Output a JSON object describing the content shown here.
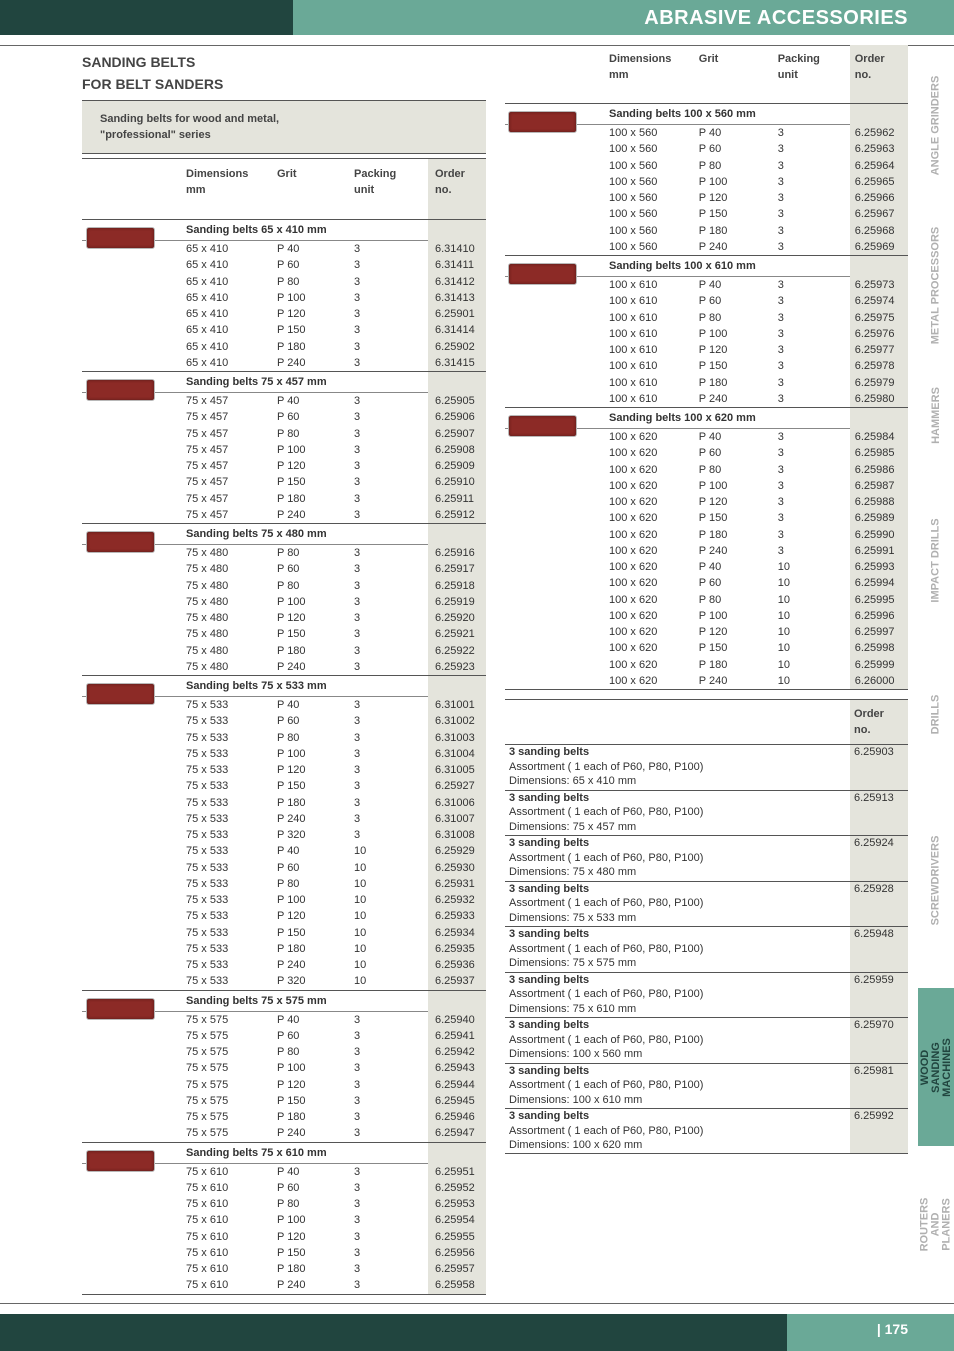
{
  "header": {
    "title": "ABRASIVE ACCESSORIES"
  },
  "footer": {
    "page": "| 175"
  },
  "section": {
    "title_line1": "SANDING BELTS",
    "title_line2": "FOR BELT SANDERS"
  },
  "intro": {
    "line1": "Sanding belts for wood and metal,",
    "line2": "\"professional\" series"
  },
  "columns": {
    "dim1": "Dimensions",
    "dim2": "mm",
    "grit": "Grit",
    "pack1": "Packing",
    "pack2": "unit",
    "ord1": "Order",
    "ord2": "no."
  },
  "left_groups": [
    {
      "title": "Sanding belts 65 x 410 mm",
      "rows": [
        [
          "65 x 410",
          "P 40",
          "3",
          "6.31410"
        ],
        [
          "65 x 410",
          "P 60",
          "3",
          "6.31411"
        ],
        [
          "65 x 410",
          "P 80",
          "3",
          "6.31412"
        ],
        [
          "65 x 410",
          "P 100",
          "3",
          "6.31413"
        ],
        [
          "65 x 410",
          "P 120",
          "3",
          "6.25901"
        ],
        [
          "65 x 410",
          "P 150",
          "3",
          "6.31414"
        ],
        [
          "65 x 410",
          "P 180",
          "3",
          "6.25902"
        ],
        [
          "65 x 410",
          "P 240",
          "3",
          "6.31415"
        ]
      ]
    },
    {
      "title": "Sanding belts 75 x 457 mm",
      "rows": [
        [
          "75 x 457",
          "P 40",
          "3",
          "6.25905"
        ],
        [
          "75 x 457",
          "P 60",
          "3",
          "6.25906"
        ],
        [
          "75 x 457",
          "P 80",
          "3",
          "6.25907"
        ],
        [
          "75 x 457",
          "P 100",
          "3",
          "6.25908"
        ],
        [
          "75 x 457",
          "P 120",
          "3",
          "6.25909"
        ],
        [
          "75 x 457",
          "P 150",
          "3",
          "6.25910"
        ],
        [
          "75 x 457",
          "P 180",
          "3",
          "6.25911"
        ],
        [
          "75 x 457",
          "P 240",
          "3",
          "6.25912"
        ]
      ]
    },
    {
      "title": "Sanding belts 75 x 480 mm",
      "rows": [
        [
          "75 x 480",
          "P 80",
          "3",
          "6.25916"
        ],
        [
          "75 x 480",
          "P 60",
          "3",
          "6.25917"
        ],
        [
          "75 x 480",
          "P 80",
          "3",
          "6.25918"
        ],
        [
          "75 x 480",
          "P 100",
          "3",
          "6.25919"
        ],
        [
          "75 x 480",
          "P 120",
          "3",
          "6.25920"
        ],
        [
          "75 x 480",
          "P 150",
          "3",
          "6.25921"
        ],
        [
          "75 x 480",
          "P 180",
          "3",
          "6.25922"
        ],
        [
          "75 x 480",
          "P 240",
          "3",
          "6.25923"
        ]
      ]
    },
    {
      "title": "Sanding belts 75 x 533 mm",
      "rows": [
        [
          "75 x 533",
          "P 40",
          "3",
          "6.31001"
        ],
        [
          "75 x 533",
          "P 60",
          "3",
          "6.31002"
        ],
        [
          "75 x 533",
          "P 80",
          "3",
          "6.31003"
        ],
        [
          "75 x 533",
          "P 100",
          "3",
          "6.31004"
        ],
        [
          "75 x 533",
          "P 120",
          "3",
          "6.31005"
        ],
        [
          "75 x 533",
          "P 150",
          "3",
          "6.25927"
        ],
        [
          "75 x 533",
          "P 180",
          "3",
          "6.31006"
        ],
        [
          "75 x 533",
          "P 240",
          "3",
          "6.31007"
        ],
        [
          "75 x 533",
          "P 320",
          "3",
          "6.31008"
        ],
        [
          "75 x 533",
          "P 40",
          "10",
          "6.25929"
        ],
        [
          "75 x 533",
          "P 60",
          "10",
          "6.25930"
        ],
        [
          "75 x 533",
          "P 80",
          "10",
          "6.25931"
        ],
        [
          "75 x 533",
          "P 100",
          "10",
          "6.25932"
        ],
        [
          "75 x 533",
          "P 120",
          "10",
          "6.25933"
        ],
        [
          "75 x 533",
          "P 150",
          "10",
          "6.25934"
        ],
        [
          "75 x 533",
          "P 180",
          "10",
          "6.25935"
        ],
        [
          "75 x 533",
          "P 240",
          "10",
          "6.25936"
        ],
        [
          "75 x 533",
          "P 320",
          "10",
          "6.25937"
        ]
      ]
    },
    {
      "title": "Sanding belts 75 x 575 mm",
      "rows": [
        [
          "75 x 575",
          "P 40",
          "3",
          "6.25940"
        ],
        [
          "75 x 575",
          "P 60",
          "3",
          "6.25941"
        ],
        [
          "75 x 575",
          "P 80",
          "3",
          "6.25942"
        ],
        [
          "75 x 575",
          "P 100",
          "3",
          "6.25943"
        ],
        [
          "75 x 575",
          "P 120",
          "3",
          "6.25944"
        ],
        [
          "75 x 575",
          "P 150",
          "3",
          "6.25945"
        ],
        [
          "75 x 575",
          "P 180",
          "3",
          "6.25946"
        ],
        [
          "75 x 575",
          "P 240",
          "3",
          "6.25947"
        ]
      ]
    },
    {
      "title": "Sanding belts 75 x 610 mm",
      "rows": [
        [
          "75 x 610",
          "P 40",
          "3",
          "6.25951"
        ],
        [
          "75 x 610",
          "P 60",
          "3",
          "6.25952"
        ],
        [
          "75 x 610",
          "P 80",
          "3",
          "6.25953"
        ],
        [
          "75 x 610",
          "P 100",
          "3",
          "6.25954"
        ],
        [
          "75 x 610",
          "P 120",
          "3",
          "6.25955"
        ],
        [
          "75 x 610",
          "P 150",
          "3",
          "6.25956"
        ],
        [
          "75 x 610",
          "P 180",
          "3",
          "6.25957"
        ],
        [
          "75 x 610",
          "P 240",
          "3",
          "6.25958"
        ]
      ]
    }
  ],
  "right_groups": [
    {
      "title": "Sanding belts 100 x 560 mm",
      "rows": [
        [
          "100 x 560",
          "P 40",
          "3",
          "6.25962"
        ],
        [
          "100 x 560",
          "P 60",
          "3",
          "6.25963"
        ],
        [
          "100 x 560",
          "P 80",
          "3",
          "6.25964"
        ],
        [
          "100 x 560",
          "P 100",
          "3",
          "6.25965"
        ],
        [
          "100 x 560",
          "P 120",
          "3",
          "6.25966"
        ],
        [
          "100 x 560",
          "P 150",
          "3",
          "6.25967"
        ],
        [
          "100 x 560",
          "P 180",
          "3",
          "6.25968"
        ],
        [
          "100 x 560",
          "P 240",
          "3",
          "6.25969"
        ]
      ]
    },
    {
      "title": "Sanding belts 100 x 610 mm",
      "rows": [
        [
          "100 x 610",
          "P 40",
          "3",
          "6.25973"
        ],
        [
          "100 x 610",
          "P 60",
          "3",
          "6.25974"
        ],
        [
          "100 x 610",
          "P 80",
          "3",
          "6.25975"
        ],
        [
          "100 x 610",
          "P 100",
          "3",
          "6.25976"
        ],
        [
          "100 x 610",
          "P 120",
          "3",
          "6.25977"
        ],
        [
          "100 x 610",
          "P 150",
          "3",
          "6.25978"
        ],
        [
          "100 x 610",
          "P 180",
          "3",
          "6.25979"
        ],
        [
          "100 x 610",
          "P 240",
          "3",
          "6.25980"
        ]
      ]
    },
    {
      "title": "Sanding belts 100 x 620 mm",
      "rows": [
        [
          "100 x 620",
          "P 40",
          "3",
          "6.25984"
        ],
        [
          "100 x 620",
          "P 60",
          "3",
          "6.25985"
        ],
        [
          "100 x 620",
          "P 80",
          "3",
          "6.25986"
        ],
        [
          "100 x 620",
          "P 100",
          "3",
          "6.25987"
        ],
        [
          "100 x 620",
          "P 120",
          "3",
          "6.25988"
        ],
        [
          "100 x 620",
          "P 150",
          "3",
          "6.25989"
        ],
        [
          "100 x 620",
          "P 180",
          "3",
          "6.25990"
        ],
        [
          "100 x 620",
          "P 240",
          "3",
          "6.25991"
        ],
        [
          "100 x 620",
          "P 40",
          "10",
          "6.25993"
        ],
        [
          "100 x 620",
          "P 60",
          "10",
          "6.25994"
        ],
        [
          "100 x 620",
          "P 80",
          "10",
          "6.25995"
        ],
        [
          "100 x 620",
          "P 100",
          "10",
          "6.25996"
        ],
        [
          "100 x 620",
          "P 120",
          "10",
          "6.25997"
        ],
        [
          "100 x 620",
          "P 150",
          "10",
          "6.25998"
        ],
        [
          "100 x 620",
          "P 180",
          "10",
          "6.25999"
        ],
        [
          "100 x 620",
          "P 240",
          "10",
          "6.26000"
        ]
      ]
    }
  ],
  "assortments": {
    "order_header1": "Order",
    "order_header2": "no.",
    "items": [
      {
        "title": "3 sanding belts",
        "desc": "Assortment ( 1 each of P60, P80, P100)",
        "dims": "Dimensions: 65 x 410 mm",
        "order": "6.25903"
      },
      {
        "title": "3 sanding belts",
        "desc": "Assortment ( 1 each of P60, P80, P100)",
        "dims": "Dimensions: 75 x 457 mm",
        "order": "6.25913"
      },
      {
        "title": "3 sanding belts",
        "desc": "Assortment ( 1 each of P60, P80, P100)",
        "dims": "Dimensions: 75 x 480 mm",
        "order": "6.25924"
      },
      {
        "title": "3 sanding belts",
        "desc": "Assortment ( 1 each of P60, P80, P100)",
        "dims": "Dimensions: 75 x 533 mm",
        "order": "6.25928"
      },
      {
        "title": "3 sanding belts",
        "desc": "Assortment ( 1 each of P60, P80, P100)",
        "dims": "Dimensions: 75 x 575 mm",
        "order": "6.25948"
      },
      {
        "title": "3 sanding belts",
        "desc": "Assortment ( 1 each of P60, P80, P100)",
        "dims": "Dimensions: 75 x 610 mm",
        "order": "6.25959"
      },
      {
        "title": "3 sanding belts",
        "desc": "Assortment ( 1 each of P60, P80, P100)",
        "dims": "Dimensions: 100 x 560 mm",
        "order": "6.25970"
      },
      {
        "title": "3 sanding belts",
        "desc": "Assortment ( 1 each of P60, P80, P100)",
        "dims": "Dimensions: 100 x 610 mm",
        "order": "6.25981"
      },
      {
        "title": "3 sanding belts",
        "desc": "Assortment ( 1 each of P60, P80, P100)",
        "dims": "Dimensions: 100 x 620 mm",
        "order": "6.25992"
      }
    ]
  },
  "sidebar": {
    "tabs": [
      {
        "label": "ANGLE GRINDERS",
        "active": false
      },
      {
        "label": "METAL PROCESSORS",
        "active": false
      },
      {
        "label": "HAMMERS",
        "active": false
      },
      {
        "label": "IMPACT DRILLS",
        "active": false
      },
      {
        "label": "DRILLS",
        "active": false
      },
      {
        "label": "SCREWDRIVERS",
        "active": false
      },
      {
        "label": "WOOD SANDING MACHINES",
        "active": true
      },
      {
        "label": "ROUTERS AND PLANERS",
        "active": false
      }
    ]
  },
  "colors": {
    "dark_green": "#21453f",
    "accent_green": "#6aa997",
    "belt_red": "#8c2a26",
    "shade": "#e4e4dc"
  }
}
